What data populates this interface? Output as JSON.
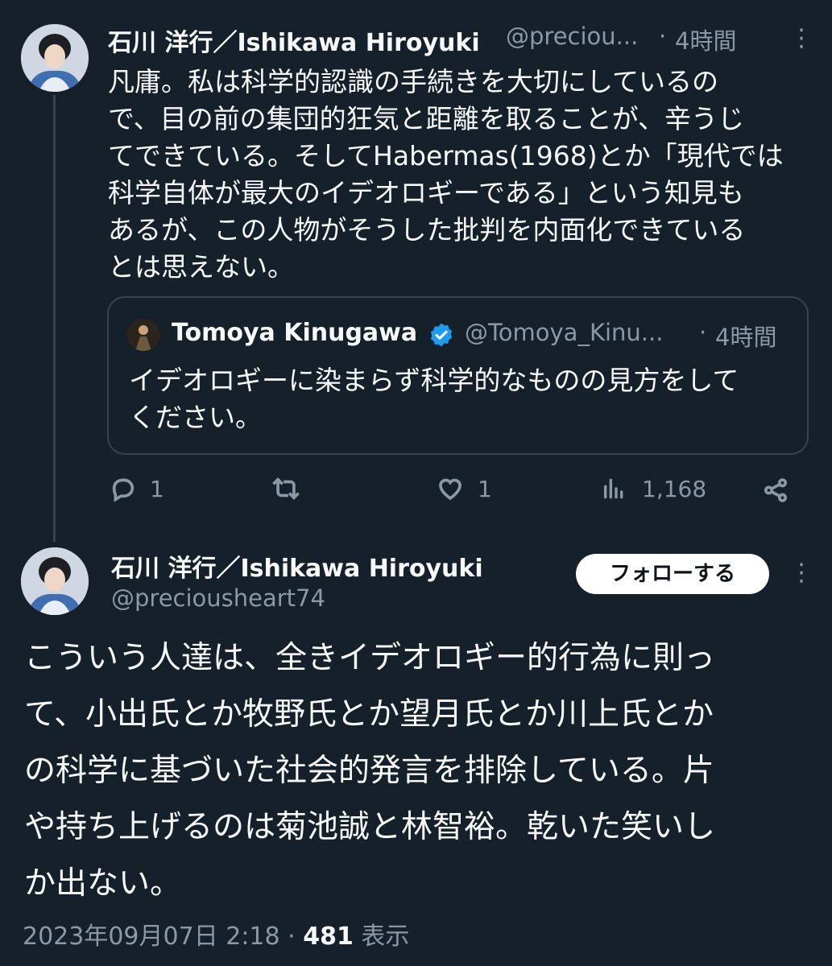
{
  "tweet1": {
    "author_name": "石川 洋行／Ishikawa Hiroyuki",
    "handle": "@preciou...",
    "sep": "·",
    "time": "4時間",
    "more": "⋮",
    "lines": [
      "凡庸。私は科学的認識の手続きを大切にしているの",
      "で、目の前の集団的狂気と距離を取ることが、辛うじ",
      "てできている。そしてHabermas(1968)とか「現代では",
      "科学自体が最大のイデオロギーである」という知見も",
      "あるが、この人物がそうした批判を内面化できている",
      "とは思えない。"
    ],
    "quote": {
      "author_name": "Tomoya Kinugawa",
      "verified_icon": "verified-badge-icon",
      "handle": "@Tomoya_Kinu...",
      "sep": "·",
      "time": "4時間",
      "lines": [
        "イデオロギーに染まらず科学的なものの見方をして",
        "ください。"
      ]
    },
    "actions": {
      "reply_count": "1",
      "retweet_count": "",
      "like_count": "1",
      "views_count": "1,168"
    }
  },
  "tweet2": {
    "author_name": "石川 洋行／Ishikawa Hiroyuki",
    "handle": "@preciousheart74",
    "follow_label": "フォローする",
    "more": "⋮",
    "lines": [
      "こういう人達は、全きイデオロギー的行為に則っ",
      "て、小出氏とか牧野氏とか望月氏とか川上氏とか",
      "の科学に基づいた社会的発言を排除している。片",
      "や持ち上げるのは菊池誠と林智裕。乾いた笑いし",
      "か出ない。"
    ],
    "meta": {
      "datetime": "2023年09月07日 2:18",
      "sep": "·",
      "views": "481",
      "views_label": "表示"
    }
  },
  "colors": {
    "background": "#15202b",
    "text": "#f7f9f9",
    "muted": "#8b98a5",
    "border": "#38444d",
    "verified": "#1d9bf0"
  }
}
